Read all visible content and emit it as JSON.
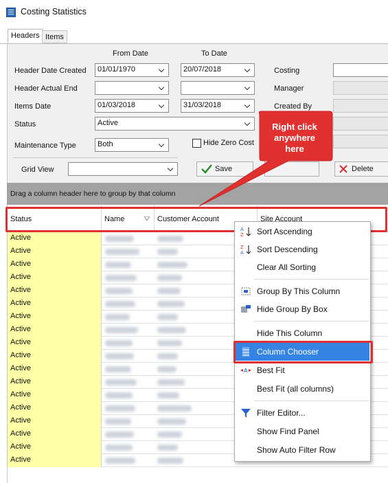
{
  "window": {
    "title": "Costing Statistics"
  },
  "tabs": [
    {
      "label": "Headers"
    },
    {
      "label": "Items"
    }
  ],
  "filters": {
    "col_from": "From Date",
    "col_to": "To Date",
    "header_date_created": {
      "label": "Header Date Created",
      "from": "01/01/1970",
      "to": "20/07/2018"
    },
    "header_actual_end": {
      "label": "Header Actual End",
      "from": "",
      "to": ""
    },
    "items_date": {
      "label": "Items Date",
      "from": "01/03/2018",
      "to": "31/03/2018"
    },
    "status": {
      "label": "Status",
      "value": "Active"
    },
    "maintenance_type": {
      "label": "Maintenance Type",
      "value": "Both"
    },
    "hide_zero_cost": {
      "label": "Hide Zero Cost",
      "checked": false
    },
    "costing": {
      "label": "Costing",
      "value": ""
    },
    "manager": {
      "label": "Manager",
      "value": ""
    },
    "created_by": {
      "label": "Created By",
      "value": ""
    }
  },
  "grid_view": {
    "label": "Grid View",
    "value": ""
  },
  "buttons": {
    "save": "Save",
    "delete": "Delete"
  },
  "group_panel": {
    "text": "Drag a column header here to group by that column"
  },
  "grid": {
    "columns": [
      "Status",
      "Name",
      "Customer Account",
      "Site Account"
    ],
    "rows": [
      "Active",
      "Active",
      "Active",
      "Active",
      "Active",
      "Active",
      "Active",
      "Active",
      "Active",
      "Active",
      "Active",
      "Active",
      "Active",
      "Active",
      "Active",
      "Active",
      "Active",
      "Active"
    ]
  },
  "context_menu": {
    "items": [
      {
        "label": "Sort Ascending",
        "icon": "sort-ascending-icon"
      },
      {
        "label": "Sort Descending",
        "icon": "sort-descending-icon"
      },
      {
        "label": "Clear All Sorting",
        "icon": ""
      },
      {
        "label": "Group By This Column",
        "icon": "group-by-icon"
      },
      {
        "label": "Hide Group By Box",
        "icon": "group-box-icon"
      },
      {
        "label": "Hide This Column",
        "icon": ""
      },
      {
        "label": "Column Chooser",
        "icon": "column-chooser-icon"
      },
      {
        "label": "Best Fit",
        "icon": "best-fit-icon"
      },
      {
        "label": "Best Fit (all columns)",
        "icon": ""
      },
      {
        "label": "Filter Editor...",
        "icon": "filter-icon"
      },
      {
        "label": "Show Find Panel",
        "icon": ""
      },
      {
        "label": "Show Auto Filter Row",
        "icon": ""
      }
    ],
    "selected": "Column Chooser"
  },
  "annotation": {
    "callout_line1": "Right click",
    "callout_line2": "anywhere",
    "callout_line3": "here",
    "color": "#e03030"
  },
  "colors": {
    "status_cell": "#ffffa8",
    "menu_highlight": "#3584e4",
    "group_panel": "#a3a3a3"
  }
}
